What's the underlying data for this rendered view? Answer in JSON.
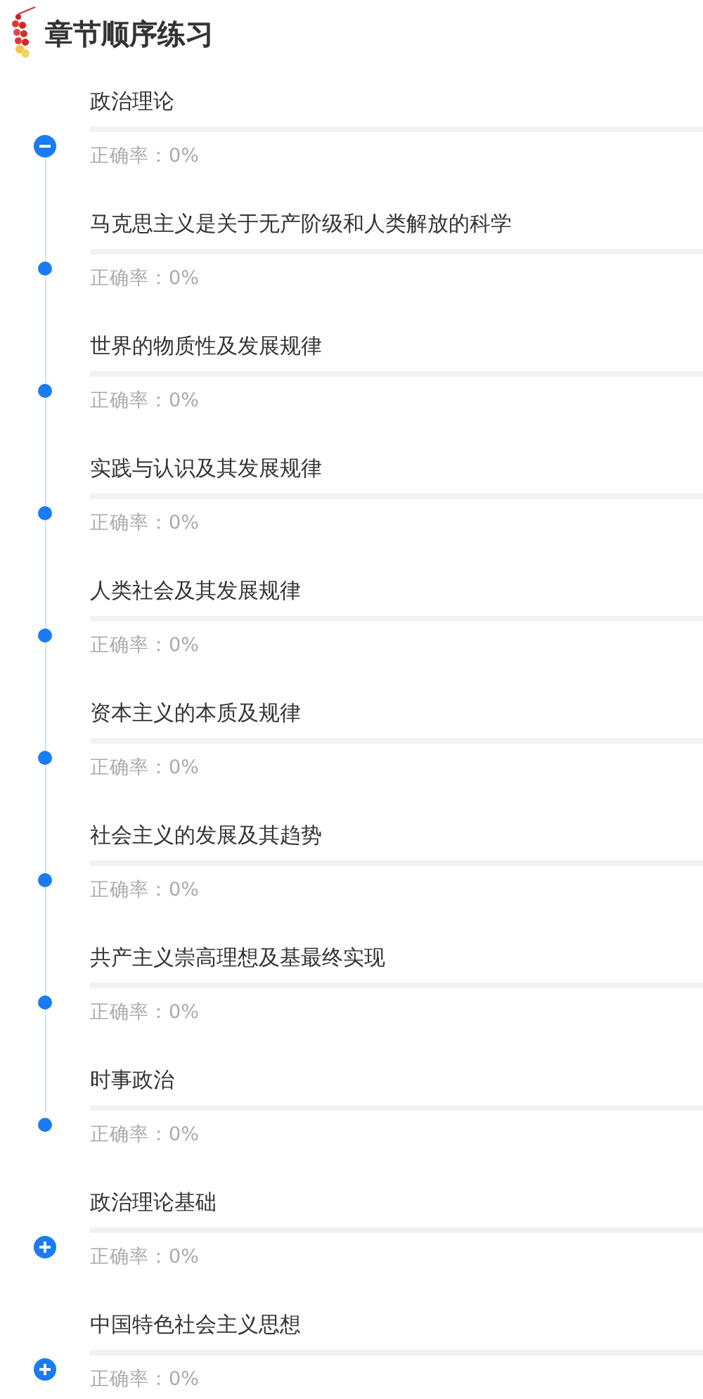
{
  "header": {
    "title": "章节顺序练习"
  },
  "chapters": [
    {
      "title": "政治理论",
      "expanded": true,
      "rate": "正确率：0%",
      "children": [
        {
          "title": "马克思主义是关于无产阶级和人类解放的科学",
          "rate": "正确率：0%"
        },
        {
          "title": "世界的物质性及发展规律",
          "rate": "正确率：0%"
        },
        {
          "title": "实践与认识及其发展规律",
          "rate": "正确率：0%"
        },
        {
          "title": "人类社会及其发展规律",
          "rate": "正确率：0%"
        },
        {
          "title": "资本主义的本质及规律",
          "rate": "正确率：0%"
        },
        {
          "title": "社会主义的发展及其趋势",
          "rate": "正确率：0%"
        },
        {
          "title": "共产主义崇高理想及基最终实现",
          "rate": "正确率：0%"
        },
        {
          "title": "时事政治",
          "rate": "正确率：0%"
        }
      ]
    },
    {
      "title": "政治理论基础",
      "expanded": false,
      "rate": "正确率：0%"
    },
    {
      "title": "中国特色社会主义思想",
      "expanded": false,
      "rate": "正确率：0%"
    }
  ]
}
